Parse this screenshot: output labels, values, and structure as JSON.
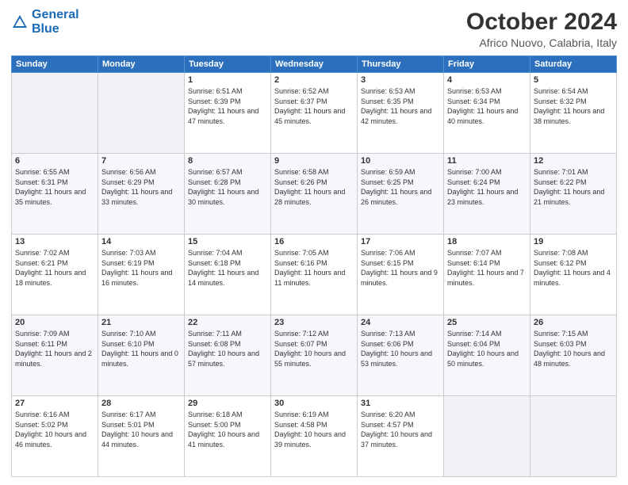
{
  "logo": {
    "line1": "General",
    "line2": "Blue"
  },
  "header": {
    "month_year": "October 2024",
    "location": "Africo Nuovo, Calabria, Italy"
  },
  "weekdays": [
    "Sunday",
    "Monday",
    "Tuesday",
    "Wednesday",
    "Thursday",
    "Friday",
    "Saturday"
  ],
  "weeks": [
    [
      {
        "day": "",
        "info": ""
      },
      {
        "day": "",
        "info": ""
      },
      {
        "day": "1",
        "info": "Sunrise: 6:51 AM\nSunset: 6:39 PM\nDaylight: 11 hours and 47 minutes."
      },
      {
        "day": "2",
        "info": "Sunrise: 6:52 AM\nSunset: 6:37 PM\nDaylight: 11 hours and 45 minutes."
      },
      {
        "day": "3",
        "info": "Sunrise: 6:53 AM\nSunset: 6:35 PM\nDaylight: 11 hours and 42 minutes."
      },
      {
        "day": "4",
        "info": "Sunrise: 6:53 AM\nSunset: 6:34 PM\nDaylight: 11 hours and 40 minutes."
      },
      {
        "day": "5",
        "info": "Sunrise: 6:54 AM\nSunset: 6:32 PM\nDaylight: 11 hours and 38 minutes."
      }
    ],
    [
      {
        "day": "6",
        "info": "Sunrise: 6:55 AM\nSunset: 6:31 PM\nDaylight: 11 hours and 35 minutes."
      },
      {
        "day": "7",
        "info": "Sunrise: 6:56 AM\nSunset: 6:29 PM\nDaylight: 11 hours and 33 minutes."
      },
      {
        "day": "8",
        "info": "Sunrise: 6:57 AM\nSunset: 6:28 PM\nDaylight: 11 hours and 30 minutes."
      },
      {
        "day": "9",
        "info": "Sunrise: 6:58 AM\nSunset: 6:26 PM\nDaylight: 11 hours and 28 minutes."
      },
      {
        "day": "10",
        "info": "Sunrise: 6:59 AM\nSunset: 6:25 PM\nDaylight: 11 hours and 26 minutes."
      },
      {
        "day": "11",
        "info": "Sunrise: 7:00 AM\nSunset: 6:24 PM\nDaylight: 11 hours and 23 minutes."
      },
      {
        "day": "12",
        "info": "Sunrise: 7:01 AM\nSunset: 6:22 PM\nDaylight: 11 hours and 21 minutes."
      }
    ],
    [
      {
        "day": "13",
        "info": "Sunrise: 7:02 AM\nSunset: 6:21 PM\nDaylight: 11 hours and 18 minutes."
      },
      {
        "day": "14",
        "info": "Sunrise: 7:03 AM\nSunset: 6:19 PM\nDaylight: 11 hours and 16 minutes."
      },
      {
        "day": "15",
        "info": "Sunrise: 7:04 AM\nSunset: 6:18 PM\nDaylight: 11 hours and 14 minutes."
      },
      {
        "day": "16",
        "info": "Sunrise: 7:05 AM\nSunset: 6:16 PM\nDaylight: 11 hours and 11 minutes."
      },
      {
        "day": "17",
        "info": "Sunrise: 7:06 AM\nSunset: 6:15 PM\nDaylight: 11 hours and 9 minutes."
      },
      {
        "day": "18",
        "info": "Sunrise: 7:07 AM\nSunset: 6:14 PM\nDaylight: 11 hours and 7 minutes."
      },
      {
        "day": "19",
        "info": "Sunrise: 7:08 AM\nSunset: 6:12 PM\nDaylight: 11 hours and 4 minutes."
      }
    ],
    [
      {
        "day": "20",
        "info": "Sunrise: 7:09 AM\nSunset: 6:11 PM\nDaylight: 11 hours and 2 minutes."
      },
      {
        "day": "21",
        "info": "Sunrise: 7:10 AM\nSunset: 6:10 PM\nDaylight: 11 hours and 0 minutes."
      },
      {
        "day": "22",
        "info": "Sunrise: 7:11 AM\nSunset: 6:08 PM\nDaylight: 10 hours and 57 minutes."
      },
      {
        "day": "23",
        "info": "Sunrise: 7:12 AM\nSunset: 6:07 PM\nDaylight: 10 hours and 55 minutes."
      },
      {
        "day": "24",
        "info": "Sunrise: 7:13 AM\nSunset: 6:06 PM\nDaylight: 10 hours and 53 minutes."
      },
      {
        "day": "25",
        "info": "Sunrise: 7:14 AM\nSunset: 6:04 PM\nDaylight: 10 hours and 50 minutes."
      },
      {
        "day": "26",
        "info": "Sunrise: 7:15 AM\nSunset: 6:03 PM\nDaylight: 10 hours and 48 minutes."
      }
    ],
    [
      {
        "day": "27",
        "info": "Sunrise: 6:16 AM\nSunset: 5:02 PM\nDaylight: 10 hours and 46 minutes."
      },
      {
        "day": "28",
        "info": "Sunrise: 6:17 AM\nSunset: 5:01 PM\nDaylight: 10 hours and 44 minutes."
      },
      {
        "day": "29",
        "info": "Sunrise: 6:18 AM\nSunset: 5:00 PM\nDaylight: 10 hours and 41 minutes."
      },
      {
        "day": "30",
        "info": "Sunrise: 6:19 AM\nSunset: 4:58 PM\nDaylight: 10 hours and 39 minutes."
      },
      {
        "day": "31",
        "info": "Sunrise: 6:20 AM\nSunset: 4:57 PM\nDaylight: 10 hours and 37 minutes."
      },
      {
        "day": "",
        "info": ""
      },
      {
        "day": "",
        "info": ""
      }
    ]
  ]
}
